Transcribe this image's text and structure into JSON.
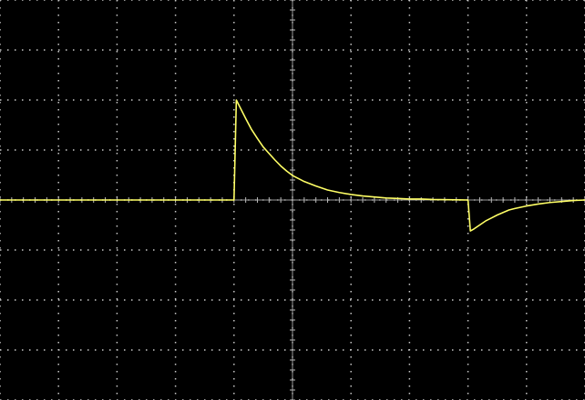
{
  "chart_data": {
    "type": "line",
    "title": "",
    "xlabel": "",
    "ylabel": "",
    "grid": true,
    "xlim": [
      -5,
      5
    ],
    "ylim": [
      -4,
      4
    ],
    "x_divisions": 10,
    "y_divisions": 8,
    "series": [
      {
        "color": "#ffff66",
        "x": [
          -5.0,
          -1.0,
          -0.98,
          -0.96,
          -0.9,
          -0.8,
          -0.7,
          -0.6,
          -0.5,
          -0.4,
          -0.3,
          -0.2,
          -0.1,
          0.0,
          0.2,
          0.4,
          0.6,
          0.8,
          1.0,
          1.2,
          1.4,
          1.6,
          1.8,
          2.0,
          2.2,
          2.4,
          3.0,
          3.02,
          3.04,
          3.1,
          3.2,
          3.3,
          3.4,
          3.5,
          3.6,
          3.7,
          3.8,
          4.0,
          4.2,
          4.4,
          4.6,
          4.8,
          5.0
        ],
        "y": [
          0.0,
          0.0,
          1.0,
          2.0,
          1.86,
          1.63,
          1.41,
          1.23,
          1.06,
          0.93,
          0.8,
          0.68,
          0.58,
          0.49,
          0.37,
          0.28,
          0.2,
          0.15,
          0.11,
          0.08,
          0.06,
          0.04,
          0.03,
          0.02,
          0.02,
          0.01,
          0.0,
          -0.3,
          -0.62,
          -0.58,
          -0.5,
          -0.42,
          -0.36,
          -0.3,
          -0.25,
          -0.2,
          -0.17,
          -0.12,
          -0.08,
          -0.05,
          -0.03,
          -0.01,
          0.0
        ]
      }
    ]
  }
}
